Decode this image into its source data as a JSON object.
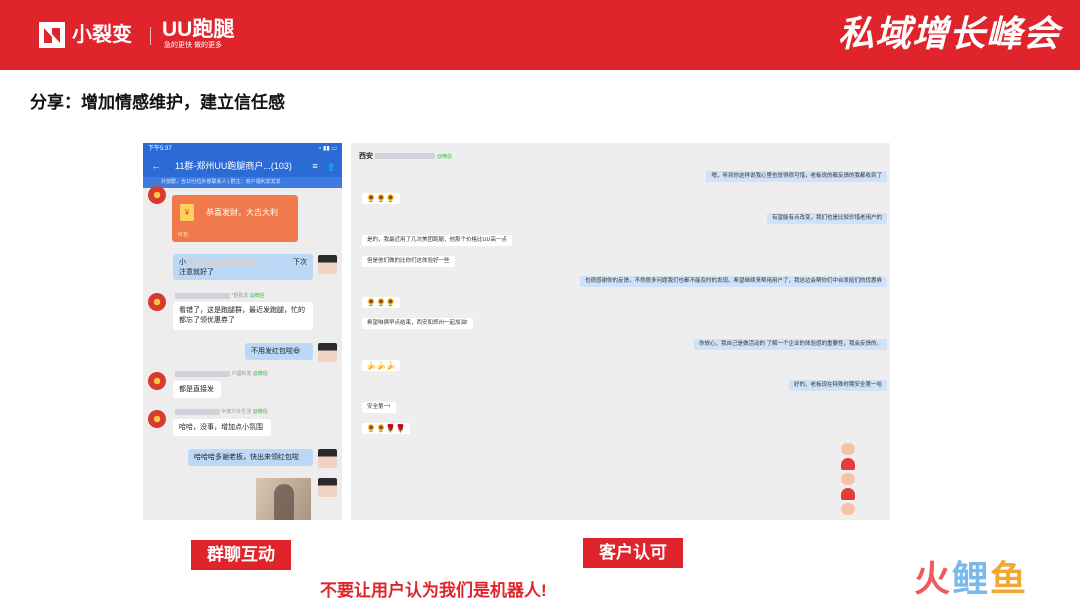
{
  "header": {
    "brand_primary": "小裂变",
    "brand_secondary": "UU跑腿",
    "brand_secondary_tagline": "急的更快 做的更多",
    "event_title": "私域增长峰会"
  },
  "slide_title": "分享：增加情感维护，建立信任感",
  "phone": {
    "status_time": "下午5:37",
    "status_icons": "◔ ▮▮ ▭",
    "chat_title": "11群-郑州UU跑腿商户...(103)",
    "notice": "外部群，含10分位外部联系人 | 群主：商户福利发发发",
    "red_packet_text": "恭喜发财，大吉大利",
    "red_packet_footer": "红包",
    "messages": {
      "m1_prefix": "小",
      "m1_suffix": "下次",
      "m1_line2": "注意就好了",
      "m2_nick_tag": "@微信",
      "m2_nick_suffix": "*姐批发",
      "m2_text": "看错了，这是跑腿群，最近发跑腿，忙的都忘了领优惠券了",
      "m3_text": "不用发红包啦😆",
      "m4_nick_suffix": "户福利发",
      "m4_nick_tag": "@微信",
      "m4_text": "都是直接发",
      "m5_nick_suffix": "半家户外生活",
      "m5_nick_tag": "@微信",
      "m5_text": "哈哈，没事，增加点小氛围",
      "m6_text": "哈哈哈多谢老板，快出来领红包啦"
    }
  },
  "chat": {
    "contact_name": "西安",
    "contact_tag": "@微信",
    "messages": [
      "嗯，听到你这样说我心里也觉得很可惜，老板说的都反馈的我都收到了",
      "有望能有点改变，我们也是比较珍惜老用户的",
      "是的，我最近用了几次美团跑腿，他那个价格比UU高一点",
      "但是他们做的比你们这体验好一些",
      "也很感谢你的反馈，不然很多问题我们也都不能及时的发现。希望继续来帮用用户了，我这边会帮你们中台发给们的优惠券",
      "希望咱俩早点结束，西安和郑州一起加油!",
      "你放心，我自己是做活动的 了解一个企业的体验感的重要性，我会反馈的。",
      "好的，老板现在特殊时期安全第一哈",
      "安全第一!"
    ],
    "emoji_rows": [
      "🌻🌻🌻",
      "🌻🌻🌻",
      "🍌🍌🍌",
      "🌻🌻🌹🌹"
    ]
  },
  "labels": {
    "left": "群聊互动",
    "right": "客户认可",
    "warning": "不要让用户认为我们是机器人!"
  },
  "watermark": [
    "火",
    "鲤",
    "鱼"
  ],
  "colors": {
    "brand_red": "#e0242b",
    "wechat_blue": "#2c6bd6",
    "bubble_blue": "#bcd8f7"
  }
}
